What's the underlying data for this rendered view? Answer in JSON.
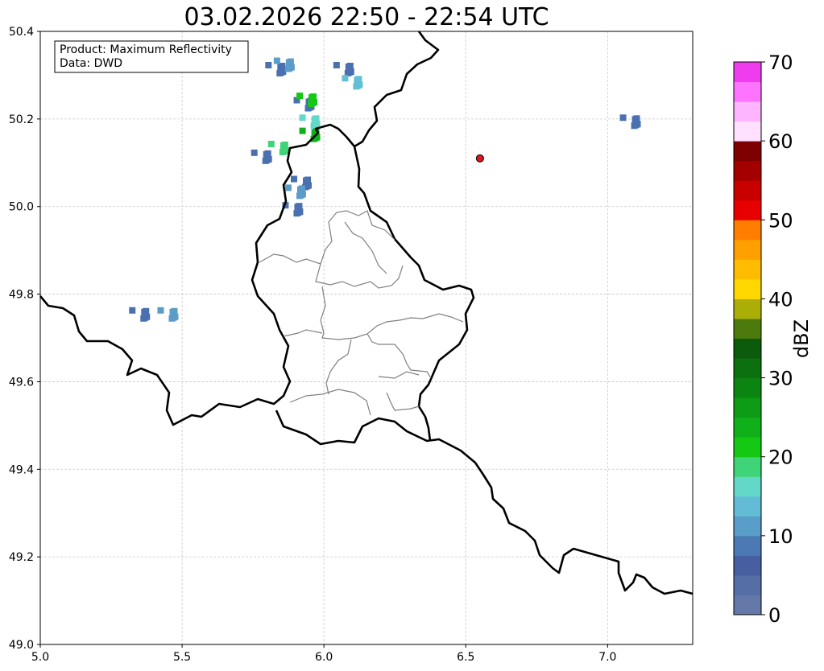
{
  "title": "03.02.2026 22:50 - 22:54 UTC",
  "info_box": {
    "line1": "Product: Maximum Reflectivity",
    "line2": "Data: DWD"
  },
  "map": {
    "x_range": [
      5.0,
      7.3
    ],
    "y_range": [
      49.0,
      50.4
    ],
    "x_ticks": [
      "5.0",
      "5.5",
      "6.0",
      "6.5",
      "7.0"
    ],
    "x_tick_values": [
      5.0,
      5.5,
      6.0,
      6.5,
      7.0
    ],
    "y_ticks": [
      "49.0",
      "49.2",
      "49.4",
      "49.6",
      "49.8",
      "50.0",
      "50.2",
      "50.4"
    ],
    "y_tick_values": [
      49.0,
      49.2,
      49.4,
      49.6,
      49.8,
      50.0,
      50.2,
      50.4
    ],
    "grid": true,
    "marker": {
      "lon": 6.55,
      "lat": 50.11,
      "color": "#e0141e"
    }
  },
  "colorbar": {
    "label": "dBZ",
    "range": [
      0,
      70
    ],
    "ticks": [
      "0",
      "10",
      "20",
      "30",
      "40",
      "50",
      "60",
      "70"
    ],
    "tick_values": [
      0,
      10,
      20,
      30,
      40,
      50,
      60,
      70
    ],
    "step": 2.5,
    "colors": [
      "#6478aa",
      "#566ea6",
      "#475fa0",
      "#4c78b4",
      "#589ec8",
      "#62bcd6",
      "#64d8c8",
      "#40d478",
      "#14c814",
      "#10b01a",
      "#0e9c16",
      "#0c8412",
      "#0c700e",
      "#0c5a0c",
      "#4c7a0c",
      "#acae08",
      "#ffd800",
      "#ffbc00",
      "#ffa000",
      "#ff7e00",
      "#e80000",
      "#c80000",
      "#a40000",
      "#7e0000",
      "#ffe0ff",
      "#ffb4ff",
      "#ff74ff",
      "#ee3cee"
    ]
  },
  "radar_cells": [
    {
      "lon": 5.83,
      "lat": 50.31,
      "color": "#4a70b0"
    },
    {
      "lon": 5.86,
      "lat": 50.32,
      "color": "#5c9cc8"
    },
    {
      "lon": 6.07,
      "lat": 50.31,
      "color": "#4a70b0"
    },
    {
      "lon": 6.1,
      "lat": 50.28,
      "color": "#62c0d4"
    },
    {
      "lon": 5.93,
      "lat": 50.23,
      "color": "#4a70b0"
    },
    {
      "lon": 5.94,
      "lat": 50.24,
      "color": "#14c814"
    },
    {
      "lon": 5.95,
      "lat": 50.19,
      "color": "#64d8c8"
    },
    {
      "lon": 5.95,
      "lat": 50.16,
      "color": "#10b01a"
    },
    {
      "lon": 5.84,
      "lat": 50.13,
      "color": "#40d478"
    },
    {
      "lon": 5.78,
      "lat": 50.11,
      "color": "#4a70b0"
    },
    {
      "lon": 5.92,
      "lat": 50.05,
      "color": "#4a70b0"
    },
    {
      "lon": 5.9,
      "lat": 50.03,
      "color": "#5c9cc8"
    },
    {
      "lon": 5.89,
      "lat": 49.99,
      "color": "#4a70b0"
    },
    {
      "lon": 5.35,
      "lat": 49.75,
      "color": "#4a70b0"
    },
    {
      "lon": 5.45,
      "lat": 49.75,
      "color": "#5c9cc8"
    },
    {
      "lon": 7.08,
      "lat": 50.19,
      "color": "#4a70b0"
    }
  ]
}
